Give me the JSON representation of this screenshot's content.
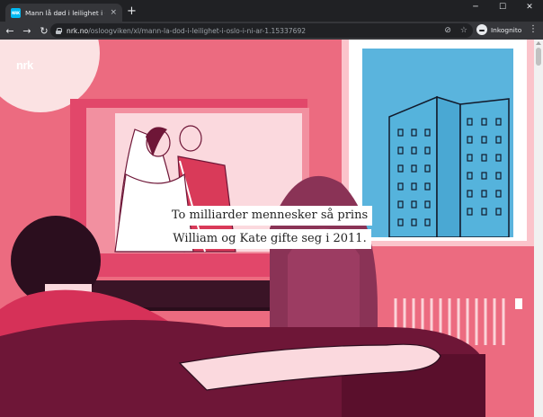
{
  "browser": {
    "tab_title": "Mann lå død i leilighet i Oslo i ni år",
    "tab_close": "×",
    "new_tab": "+",
    "window_controls": {
      "minimize": "─",
      "maximize": "☐",
      "close": "✕"
    },
    "nav": {
      "back": "←",
      "forward": "→",
      "reload": "↻"
    },
    "url_host": "nrk.no",
    "url_path": "/osloogviken/xl/mann-la-dod-i-leilighet-i-oslo-i-ni-ar-1.15337692",
    "omnibox_icons": {
      "eye_off": "⊘",
      "star": "☆"
    },
    "incognito_label": "Inkognito",
    "menu": "⋮"
  },
  "page": {
    "logo": "nrk",
    "caption_lines": [
      "To milliarder mennesker så prins",
      "William og Kate gifte seg i 2011."
    ]
  },
  "colors": {
    "wall": "#ec6b80",
    "tv_frame": "#e2476a",
    "sofa": "#6e1637",
    "window_sky": "#5ab4dd",
    "building": "#55b3dc"
  }
}
